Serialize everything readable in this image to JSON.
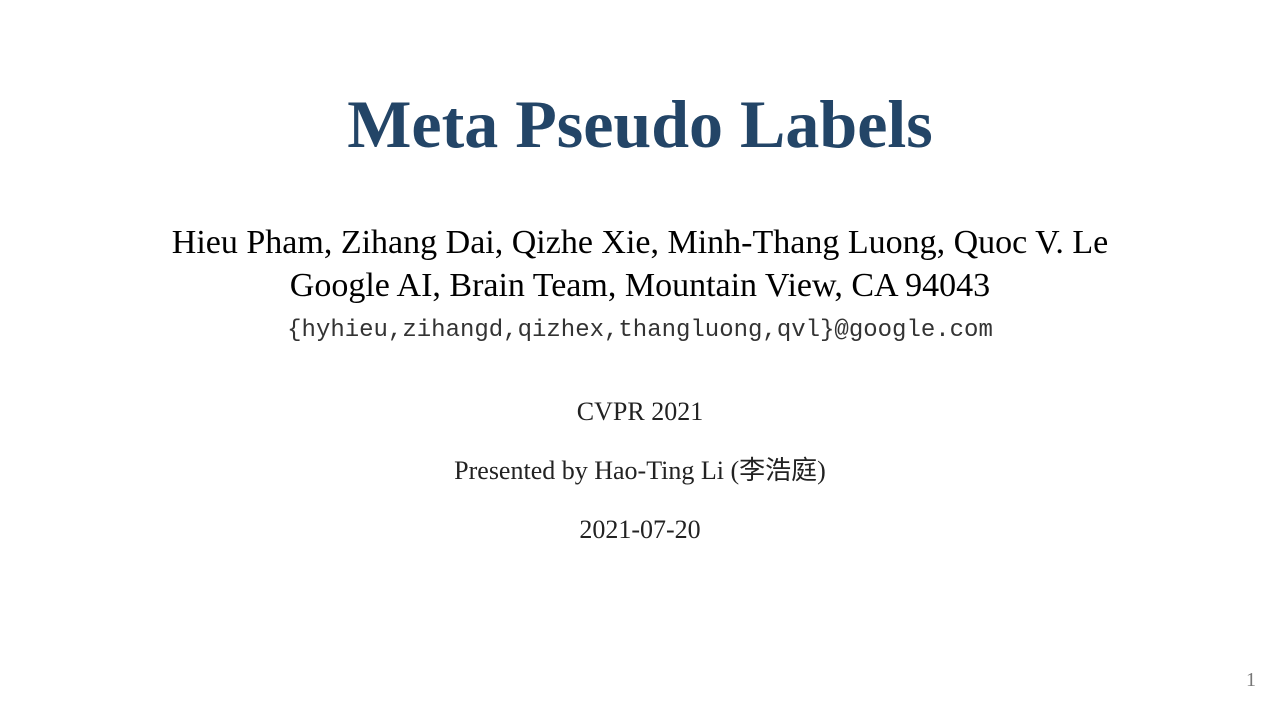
{
  "slide": {
    "title": "Meta Pseudo Labels",
    "authors": "Hieu Pham, Zihang Dai, Qizhe Xie, Minh-Thang Luong, Quoc V. Le",
    "affiliation": "Google AI, Brain Team, Mountain View, CA 94043",
    "emails": "{hyhieu,zihangd,qizhex,thangluong,qvl}@google.com",
    "venue": "CVPR 2021",
    "presenter": "Presented by Hao-Ting Li (李浩庭)",
    "date": "2021-07-20",
    "page_number": "1"
  },
  "colors": {
    "title": "#234567",
    "body_text": "#222222",
    "page_number": "#777777"
  }
}
